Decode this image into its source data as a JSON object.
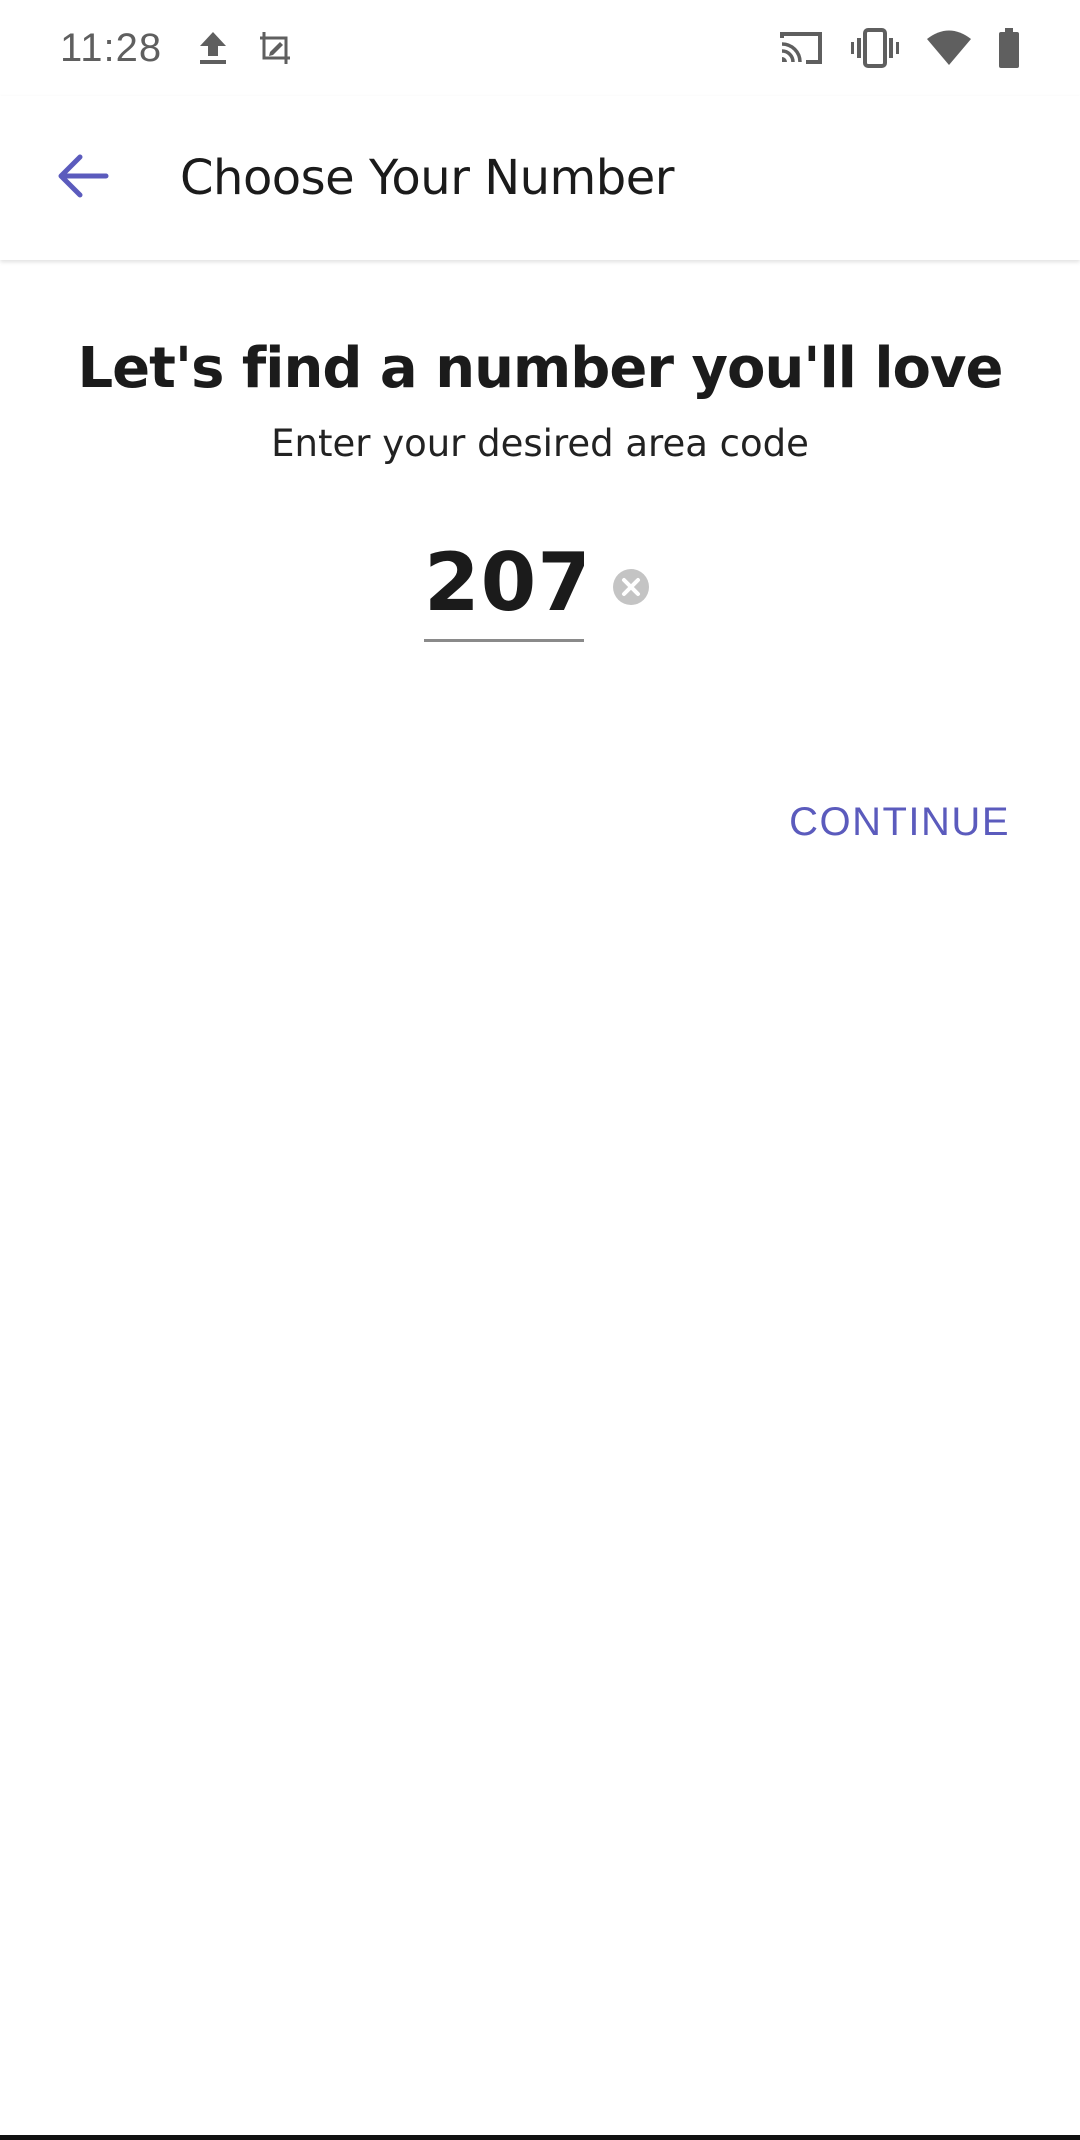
{
  "status_bar": {
    "time": "11:28",
    "left_icons": [
      "upload-icon",
      "screenshot-edit-icon"
    ],
    "right_icons": [
      "cast-icon",
      "vibrate-icon",
      "wifi-icon",
      "battery-icon"
    ]
  },
  "app_bar": {
    "back_icon": "arrow-back-icon",
    "title": "Choose Your Number"
  },
  "main": {
    "headline": "Let's find a number you'll love",
    "subhead": "Enter your desired area code",
    "area_code_value": "207",
    "clear_icon": "clear-circle-icon",
    "continue_label": "CONTINUE"
  },
  "colors": {
    "accent": "#5b5bbd",
    "text": "#1b1b1b",
    "status_icons": "#5f5f5f"
  }
}
